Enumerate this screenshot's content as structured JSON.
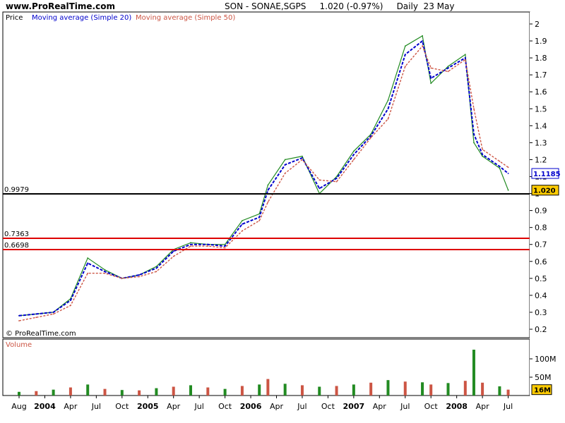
{
  "header": {
    "site": "www.ProRealTime.com",
    "ticker": "SON - SONAE,SGPS",
    "quote": "1.020 (-0.97%)",
    "period": "Daily  23 May"
  },
  "legend": {
    "price": "Price",
    "ma20": "Moving average (Simple 20)",
    "ma50": "Moving average (Simple 50)"
  },
  "watermark": "© ProRealTime.com",
  "volume_label": "Volume",
  "colors": {
    "price": "#228B22",
    "ma20": "#0000CC",
    "ma50": "#CC5544",
    "hline_black": "#000000",
    "hline_red": "#DD0000",
    "price_tag": "#FFCC00",
    "ma20_tag_border": "#0000CC"
  },
  "chart_data": [
    {
      "type": "line",
      "title": "SON - SONAE,SGPS",
      "xlabel": "",
      "ylabel": "",
      "x_ticks": [
        "Aug",
        "2004",
        "Apr",
        "Jul",
        "Oct",
        "2005",
        "Apr",
        "Jul",
        "Oct",
        "2006",
        "Apr",
        "Jul",
        "Oct",
        "2007",
        "Apr",
        "Jul",
        "Oct",
        "2008",
        "Apr",
        "Jul"
      ],
      "y_ticks": [
        "0.2",
        "0.3",
        "0.4",
        "0.5",
        "0.6",
        "0.7",
        "0.8",
        "0.9",
        "1",
        "1.1",
        "1.2",
        "1.3",
        "1.4",
        "1.5",
        "1.6",
        "1.7",
        "1.8",
        "1.9",
        "2"
      ],
      "ylim": [
        0.15,
        2.05
      ],
      "x": [
        "2003-08",
        "2003-10",
        "2003-12",
        "2004-02",
        "2004-04",
        "2004-06",
        "2004-08",
        "2004-10",
        "2004-12",
        "2005-02",
        "2005-04",
        "2005-06",
        "2005-08",
        "2005-10",
        "2005-12",
        "2006-01",
        "2006-03",
        "2006-05",
        "2006-07",
        "2006-09",
        "2006-11",
        "2007-01",
        "2007-03",
        "2007-05",
        "2007-07",
        "2007-08",
        "2007-10",
        "2007-12",
        "2008-01",
        "2008-02",
        "2008-04",
        "2008-05"
      ],
      "series": [
        {
          "name": "Price",
          "values": [
            0.28,
            0.29,
            0.3,
            0.38,
            0.62,
            0.55,
            0.5,
            0.52,
            0.57,
            0.67,
            0.71,
            0.7,
            0.7,
            0.84,
            0.88,
            1.05,
            1.2,
            1.22,
            1.0,
            1.1,
            1.25,
            1.35,
            1.55,
            1.87,
            1.93,
            1.65,
            1.75,
            1.82,
            1.3,
            1.22,
            1.15,
            1.02
          ]
        },
        {
          "name": "Moving average (Simple 20)",
          "values": [
            0.28,
            0.29,
            0.3,
            0.37,
            0.59,
            0.54,
            0.5,
            0.52,
            0.56,
            0.66,
            0.7,
            0.7,
            0.69,
            0.82,
            0.86,
            1.02,
            1.17,
            1.21,
            1.03,
            1.09,
            1.23,
            1.34,
            1.5,
            1.82,
            1.9,
            1.68,
            1.74,
            1.8,
            1.35,
            1.23,
            1.16,
            1.1185
          ]
        },
        {
          "name": "Moving average (Simple 50)",
          "values": [
            0.25,
            0.27,
            0.29,
            0.34,
            0.53,
            0.53,
            0.5,
            0.51,
            0.54,
            0.63,
            0.69,
            0.69,
            0.68,
            0.78,
            0.84,
            0.95,
            1.12,
            1.2,
            1.08,
            1.07,
            1.2,
            1.33,
            1.44,
            1.75,
            1.87,
            1.74,
            1.72,
            1.79,
            1.5,
            1.26,
            1.19,
            1.155
          ]
        }
      ],
      "hlines": [
        {
          "label": "0.9979",
          "value": 0.9979,
          "color": "black"
        },
        {
          "label": "0.7363",
          "value": 0.7363,
          "color": "red"
        },
        {
          "label": "0.6698",
          "value": 0.6698,
          "color": "red"
        }
      ],
      "right_tags": [
        {
          "label": "1.1185",
          "value": 1.1185,
          "kind": "ma20"
        },
        {
          "label": "1.020",
          "value": 1.02,
          "kind": "price"
        }
      ],
      "grid": false
    },
    {
      "type": "bar",
      "title": "Volume",
      "y_ticks": [
        "50M",
        "100M"
      ],
      "ylim": [
        0,
        130
      ],
      "last_tag": "16M",
      "x": [
        "2003-08",
        "2003-10",
        "2003-12",
        "2004-02",
        "2004-04",
        "2004-06",
        "2004-08",
        "2004-10",
        "2004-12",
        "2005-02",
        "2005-04",
        "2005-06",
        "2005-08",
        "2005-10",
        "2005-12",
        "2006-01",
        "2006-03",
        "2006-05",
        "2006-07",
        "2006-09",
        "2006-11",
        "2007-01",
        "2007-03",
        "2007-05",
        "2007-07",
        "2007-08",
        "2007-10",
        "2007-12",
        "2008-01",
        "2008-02",
        "2008-04",
        "2008-05"
      ],
      "values": [
        10,
        12,
        16,
        22,
        30,
        18,
        15,
        14,
        20,
        24,
        28,
        22,
        18,
        26,
        30,
        45,
        32,
        28,
        24,
        26,
        30,
        35,
        42,
        38,
        36,
        30,
        34,
        40,
        125,
        35,
        25,
        16
      ]
    }
  ]
}
